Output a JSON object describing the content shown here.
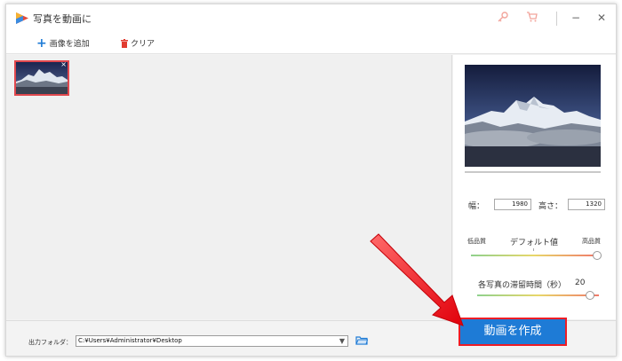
{
  "window": {
    "title": "写真を動画に"
  },
  "titlebar_icons": {
    "key": "key-icon",
    "cart": "cart-icon"
  },
  "window_controls": {
    "minimize": "−",
    "close": "✕"
  },
  "toolbar": {
    "add_image_label": "画像を追加",
    "clear_label": "クリア"
  },
  "thumbnails": [
    {
      "name": "mountain-photo",
      "close": "×"
    }
  ],
  "settings": {
    "width_label": "幅：",
    "width_value": "1980",
    "height_label": "高さ：",
    "height_value": "1320",
    "quality_low": "低品質",
    "quality_default": "デフォルト値",
    "quality_high": "高品質",
    "quality_level": 1.0,
    "duration_label": "各写真の滞留時間（秒）",
    "duration_value": "20",
    "duration_level": 0.93
  },
  "output": {
    "folder_label": "出力フォルダ：",
    "folder_path": "C:¥Users¥Administrator¥Desktop"
  },
  "create_button": {
    "label": "動画を作成"
  },
  "colors": {
    "accent": "#1e7bd6",
    "highlight_red": "#ee1c25"
  }
}
